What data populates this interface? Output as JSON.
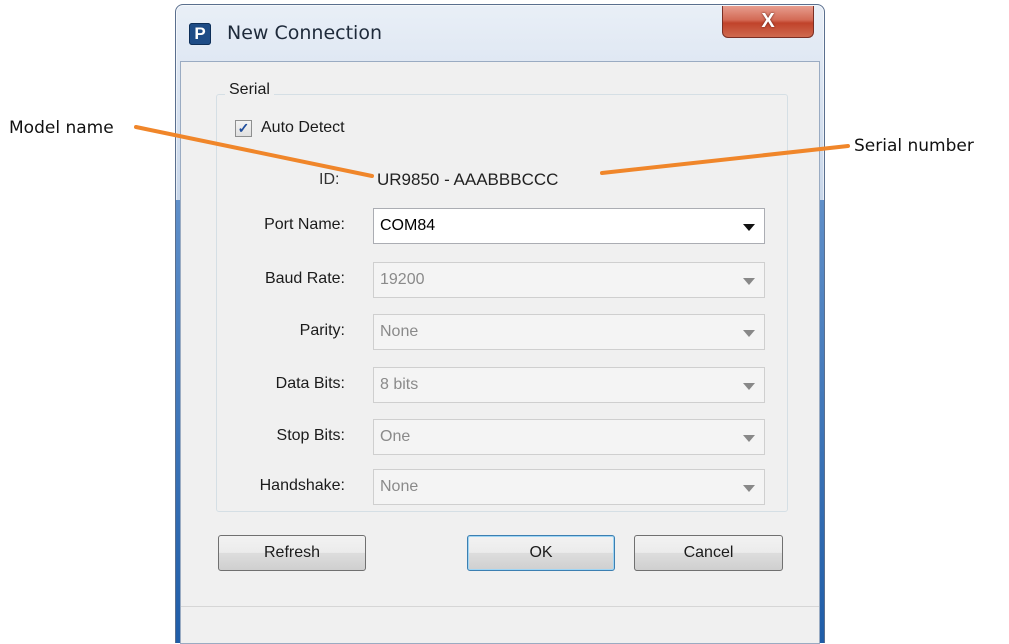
{
  "window": {
    "title": "New Connection",
    "icon_letter": "P",
    "close_glyph": "X"
  },
  "group": {
    "label": "Serial"
  },
  "auto_detect": {
    "label": "Auto Detect",
    "checked": true
  },
  "id": {
    "label": "ID:",
    "value": "UR9850 - AAABBBCCC"
  },
  "fields": [
    {
      "label": "Port Name:",
      "value": "COM84",
      "enabled": true
    },
    {
      "label": "Baud Rate:",
      "value": "19200",
      "enabled": false
    },
    {
      "label": "Parity:",
      "value": "None",
      "enabled": false
    },
    {
      "label": "Data Bits:",
      "value": "8 bits",
      "enabled": false
    },
    {
      "label": "Stop Bits:",
      "value": "One",
      "enabled": false
    },
    {
      "label": "Handshake:",
      "value": "None",
      "enabled": false
    }
  ],
  "buttons": {
    "refresh": "Refresh",
    "ok": "OK",
    "cancel": "Cancel"
  },
  "annotations": {
    "model_name": "Model name",
    "serial_number": "Serial number",
    "line_color": "#f0862a"
  }
}
